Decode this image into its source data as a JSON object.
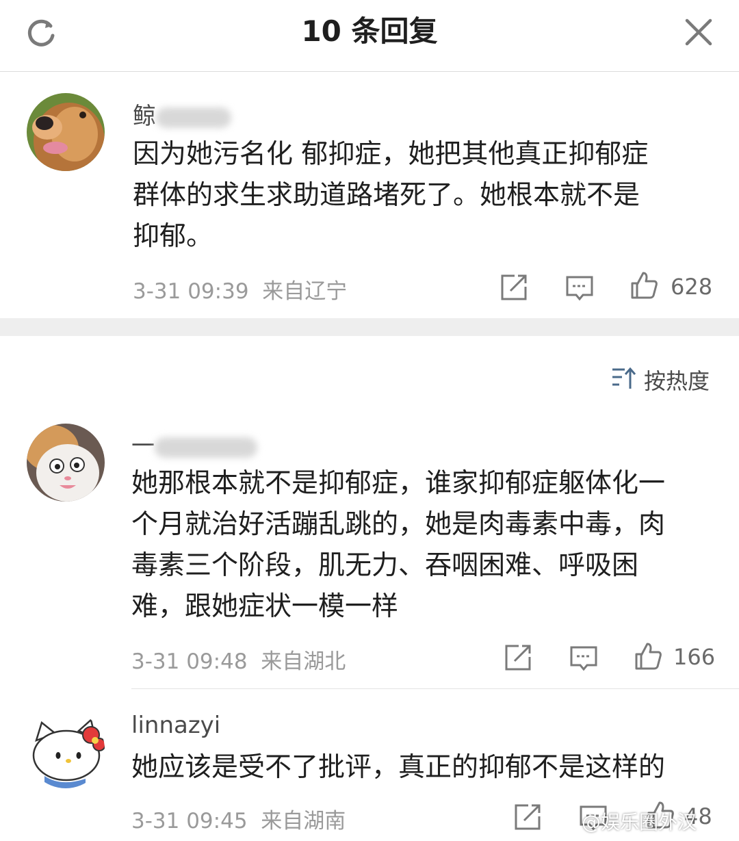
{
  "header": {
    "title": "10 条回复",
    "refresh_icon": "refresh-icon",
    "close_icon": "close-icon"
  },
  "sort": {
    "label": "按热度",
    "icon": "sort-icon"
  },
  "comments": [
    {
      "username": "鲸",
      "text": "因为她污名化 郁抑症，她把其他真正抑郁症\n群体的求生求助道路堵死了。她根本就不是\n抑郁。",
      "time": "3-31 09:39",
      "location": "来自辽宁",
      "likes": "628",
      "avatar": "dog-avatar"
    },
    {
      "username": "一",
      "text": "她那根本就不是抑郁症，谁家抑郁症躯体化一\n个月就治好活蹦乱跳的，她是肉毒素中毒，肉\n毒素三个阶段，肌无力、吞咽困难、呼吸困\n难，跟她症状一模一样",
      "time": "3-31 09:48",
      "location": "来自湖北",
      "likes": "166",
      "avatar": "cat-avatar"
    },
    {
      "username": "linnazyi",
      "text": "她应该是受不了批评，真正的抑郁不是这样的",
      "time": "3-31 09:45",
      "location": "来自湖南",
      "likes": "48",
      "avatar": "hello-kitty-avatar"
    }
  ],
  "watermark": "@娱乐圈外汉",
  "colors": {
    "icon_gray": "#7a7a7a",
    "meta_gray": "#9a9a9a",
    "sort_blue": "#4a6a8a"
  }
}
